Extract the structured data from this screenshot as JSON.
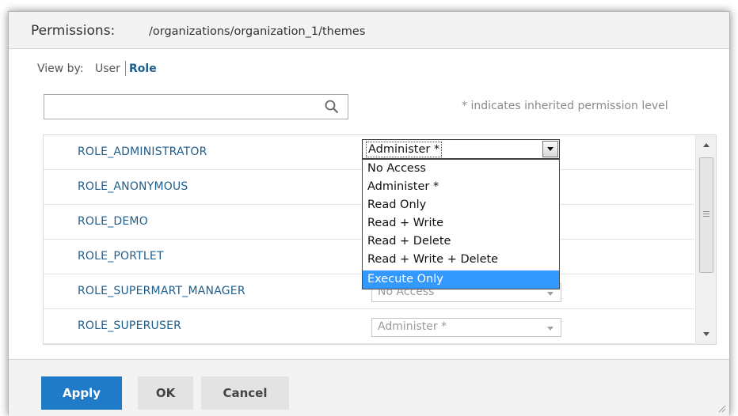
{
  "dialog": {
    "title_label": "Permissions:",
    "title_path": "/organizations/organization_1/themes"
  },
  "view_by": {
    "label": "View by:",
    "user": "User",
    "role": "Role"
  },
  "search": {
    "placeholder": "",
    "value": ""
  },
  "inherited_note": "* indicates inherited permission level",
  "rows": [
    {
      "label": "ROLE_ADMINISTRATOR",
      "permission": "Administer *"
    },
    {
      "label": "ROLE_ANONYMOUS",
      "permission": ""
    },
    {
      "label": "ROLE_DEMO",
      "permission": ""
    },
    {
      "label": "ROLE_PORTLET",
      "permission": ""
    },
    {
      "label": "ROLE_SUPERMART_MANAGER",
      "permission": "No Access"
    },
    {
      "label": "ROLE_SUPERUSER",
      "permission": "Administer *"
    }
  ],
  "dropdown": {
    "options": [
      "No Access",
      "Administer *",
      "Read Only",
      "Read + Write",
      "Read + Delete",
      "Read + Write + Delete",
      "Execute Only"
    ],
    "highlighted": "Execute Only"
  },
  "footer": {
    "apply": "Apply",
    "ok": "OK",
    "cancel": "Cancel"
  },
  "colors": {
    "link_blue": "#1f5e8b",
    "apply_blue": "#1f7bc8",
    "highlight_blue": "#3399ff"
  },
  "icons": {
    "search": "search-icon",
    "scroll_up": "chevron-up-icon",
    "scroll_down": "chevron-down-icon",
    "resize": "resize-grip-icon"
  }
}
